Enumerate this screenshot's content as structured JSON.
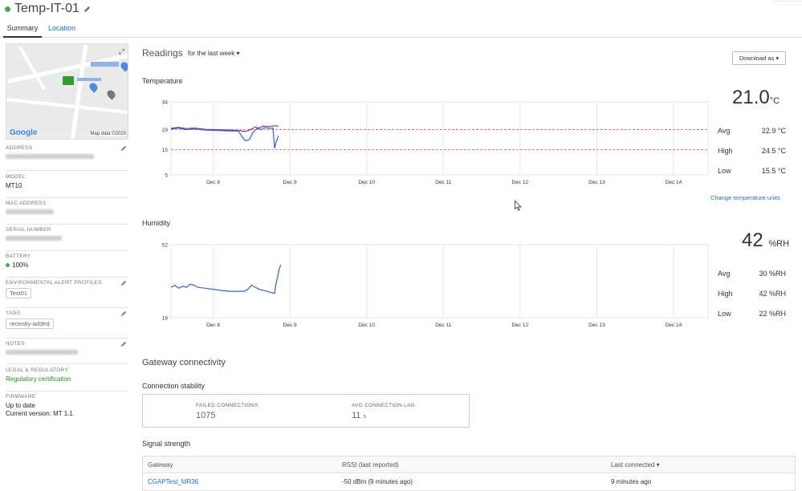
{
  "device": {
    "title": "Temp-IT-01",
    "status_color": "#4ca64c"
  },
  "tabs": [
    {
      "label": "Summary",
      "active": true
    },
    {
      "label": "Location",
      "active": false
    }
  ],
  "map": {
    "logo": "Google",
    "attribution": "Map data ©2020"
  },
  "sidebar": {
    "address_label": "ADDRESS",
    "model_label": "MODEL",
    "model_value": "MT10",
    "mac_label": "MAC ADDRESS",
    "serial_label": "SERIAL NUMBER",
    "battery_label": "BATTERY",
    "battery_value": "100%",
    "alert_profiles_label": "ENVIRONMENTAL ALERT PROFILES",
    "alert_profile_tag": "Test01",
    "tags_label": "TAGS",
    "tag_value": "recently-added",
    "notes_label": "NOTES",
    "legal_label": "LEGAL & REGULATORY",
    "legal_link": "Regulatory certification",
    "firmware_label": "FIRMWARE",
    "firmware_status": "Up to date",
    "firmware_version": "Current version: MT 1.1"
  },
  "readings": {
    "heading": "Readings",
    "period": "for the last week",
    "download": "Download as"
  },
  "temperature": {
    "title": "Temperature",
    "current": "21.0",
    "unit": "°C",
    "avg_label": "Avg",
    "avg_value": "22.9 °C",
    "high_label": "High",
    "high_value": "24.5 °C",
    "low_label": "Low",
    "low_value": "15.5 °C",
    "change_units": "Change temperature units"
  },
  "humidity": {
    "title": "Humidity",
    "current": "42",
    "unit": "%RH",
    "avg_label": "Avg",
    "avg_value": "30 %RH",
    "high_label": "High",
    "high_value": "42 %RH",
    "low_label": "Low",
    "low_value": "22 %RH"
  },
  "chart_data": [
    {
      "type": "line",
      "title": "Temperature",
      "x_ticks": [
        "Dec 8",
        "Dec 9",
        "Dec 10",
        "Dec 11",
        "Dec 12",
        "Dec 13",
        "Dec 14"
      ],
      "y_ticks": [
        "5",
        "15",
        "23",
        "34"
      ],
      "ylim": [
        5,
        34
      ],
      "xlim_days": [
        7.45,
        14.45
      ],
      "thresholds": [
        23,
        15
      ],
      "series": [
        {
          "color": "#8b3a7a",
          "x": [
            7.45,
            7.55,
            7.65,
            7.75,
            7.9,
            8.0,
            8.2,
            8.35,
            8.4,
            8.45,
            8.5,
            8.55,
            8.6,
            8.65,
            8.72,
            8.78,
            8.85
          ],
          "y": [
            23.5,
            23.9,
            23.4,
            23.6,
            23.1,
            23.0,
            22.8,
            22.6,
            22.2,
            22.5,
            23.2,
            24.0,
            23.6,
            24.4,
            24.2,
            24.5,
            24.4
          ]
        },
        {
          "color": "#3a5fcd",
          "x": [
            7.45,
            7.55,
            7.65,
            7.75,
            7.9,
            8.0,
            8.2,
            8.33,
            8.38,
            8.42,
            8.47,
            8.52,
            8.57,
            8.62,
            8.67,
            8.72,
            8.78,
            8.8,
            8.82,
            8.85
          ],
          "y": [
            23.2,
            23.6,
            23.0,
            23.3,
            22.8,
            22.7,
            22.5,
            22.4,
            20.0,
            18.5,
            19.0,
            22.0,
            23.4,
            23.0,
            23.8,
            23.5,
            23.6,
            15.5,
            18.0,
            20.5
          ]
        }
      ]
    },
    {
      "type": "line",
      "title": "Humidity",
      "x_ticks": [
        "Dec 8",
        "Dec 9",
        "Dec 10",
        "Dec 11",
        "Dec 12",
        "Dec 13",
        "Dec 14"
      ],
      "y_ticks": [
        "16",
        "52"
      ],
      "ylim": [
        16,
        52
      ],
      "xlim_days": [
        7.45,
        14.45
      ],
      "series": [
        {
          "color": "#3a5fcd",
          "x": [
            7.45,
            7.5,
            7.55,
            7.6,
            7.65,
            7.7,
            7.75,
            7.8,
            7.9,
            8.0,
            8.1,
            8.2,
            8.3,
            8.4,
            8.45,
            8.5,
            8.55,
            8.6,
            8.65,
            8.7,
            8.75,
            8.8,
            8.82,
            8.84,
            8.86,
            8.88
          ],
          "y": [
            31,
            32,
            30.5,
            31.5,
            31,
            32.5,
            32,
            31,
            30.5,
            30,
            29.5,
            29,
            29,
            29,
            30,
            32,
            31,
            30,
            29.5,
            29,
            28.5,
            28,
            33,
            36,
            40,
            42
          ]
        }
      ]
    }
  ],
  "gateway": {
    "heading": "Gateway connectivity",
    "stability_title": "Connection stability",
    "failed_label": "FAILED CONNECTIONS",
    "failed_value": "1075",
    "lag_label": "AVG CONNECTION LAG",
    "lag_value": "11",
    "lag_unit": "s",
    "signal_title": "Signal strength",
    "columns": [
      "Gateway",
      "RSSI (last reported)",
      "Last connected ▾"
    ],
    "rows": [
      {
        "gateway": "CGAPTest_MR36",
        "rssi": "-50 dBm (9 minutes ago)",
        "last": "9 minutes ago"
      }
    ]
  }
}
